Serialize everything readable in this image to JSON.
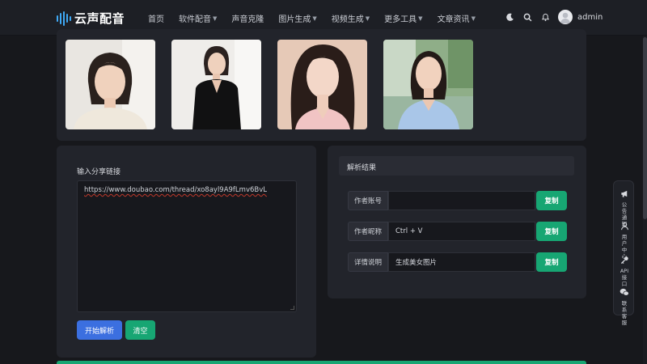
{
  "header": {
    "logo_text": "云声配音",
    "nav": [
      {
        "label": "首页",
        "dropdown": false
      },
      {
        "label": "软件配音",
        "dropdown": true
      },
      {
        "label": "声音克隆",
        "dropdown": false
      },
      {
        "label": "图片生成",
        "dropdown": true
      },
      {
        "label": "视频生成",
        "dropdown": true
      },
      {
        "label": "更多工具",
        "dropdown": true
      },
      {
        "label": "文章资讯",
        "dropdown": true
      }
    ],
    "username": "admin",
    "icons": [
      "moon-icon",
      "search-icon",
      "bell-icon",
      "user-avatar-icon"
    ]
  },
  "gallery": {
    "images": [
      {
        "name": "portrait-cream-sweater"
      },
      {
        "name": "portrait-black-blazer"
      },
      {
        "name": "portrait-pink-blouse"
      },
      {
        "name": "portrait-blue-shirt"
      }
    ]
  },
  "input_panel": {
    "label": "输入分享链接",
    "url_value": "https://www.doubao.com/thread/xo8ayl9A9fLmv6BvL",
    "parse_button": "开始解析",
    "clear_button": "清空"
  },
  "result_panel": {
    "title": "解析结果",
    "rows": [
      {
        "label": "作者账号",
        "value": "",
        "copy": "复制"
      },
      {
        "label": "作者昵称",
        "value": "Ctrl + V",
        "copy": "复制"
      },
      {
        "label": "详情说明",
        "value": "生成美女图片",
        "copy": "复制"
      }
    ]
  },
  "side_tools": [
    {
      "icon": "megaphone-icon",
      "label": "公告通知"
    },
    {
      "icon": "user-icon",
      "label": "用户中心"
    },
    {
      "icon": "key-icon",
      "label": "API接口"
    },
    {
      "icon": "wechat-icon",
      "label": "联系客服"
    }
  ],
  "colors": {
    "accent_blue": "#3b6fe0",
    "accent_green": "#17a673",
    "logo_blue": "#3fa9f5",
    "background": "#17181c",
    "panel": "#22242b"
  }
}
